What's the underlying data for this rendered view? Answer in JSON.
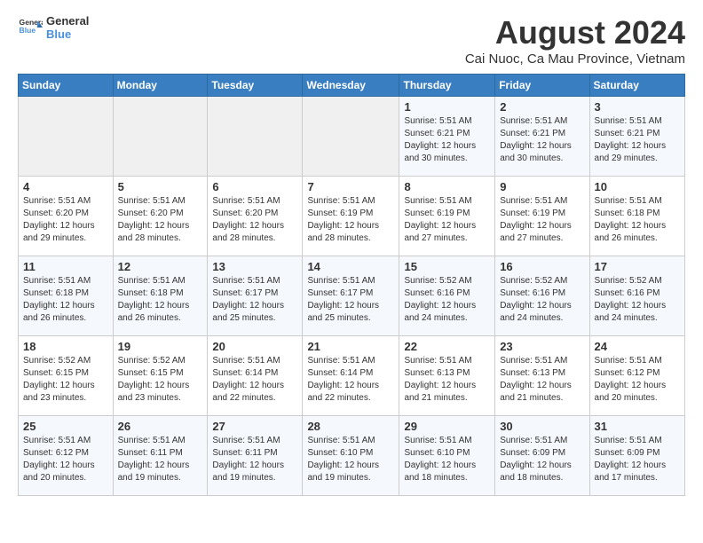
{
  "logo": {
    "line1": "General",
    "line2": "Blue"
  },
  "title": "August 2024",
  "subtitle": "Cai Nuoc, Ca Mau Province, Vietnam",
  "weekdays": [
    "Sunday",
    "Monday",
    "Tuesday",
    "Wednesday",
    "Thursday",
    "Friday",
    "Saturday"
  ],
  "weeks": [
    [
      {
        "day": "",
        "info": ""
      },
      {
        "day": "",
        "info": ""
      },
      {
        "day": "",
        "info": ""
      },
      {
        "day": "",
        "info": ""
      },
      {
        "day": "1",
        "info": "Sunrise: 5:51 AM\nSunset: 6:21 PM\nDaylight: 12 hours\nand 30 minutes."
      },
      {
        "day": "2",
        "info": "Sunrise: 5:51 AM\nSunset: 6:21 PM\nDaylight: 12 hours\nand 30 minutes."
      },
      {
        "day": "3",
        "info": "Sunrise: 5:51 AM\nSunset: 6:21 PM\nDaylight: 12 hours\nand 29 minutes."
      }
    ],
    [
      {
        "day": "4",
        "info": "Sunrise: 5:51 AM\nSunset: 6:20 PM\nDaylight: 12 hours\nand 29 minutes."
      },
      {
        "day": "5",
        "info": "Sunrise: 5:51 AM\nSunset: 6:20 PM\nDaylight: 12 hours\nand 28 minutes."
      },
      {
        "day": "6",
        "info": "Sunrise: 5:51 AM\nSunset: 6:20 PM\nDaylight: 12 hours\nand 28 minutes."
      },
      {
        "day": "7",
        "info": "Sunrise: 5:51 AM\nSunset: 6:19 PM\nDaylight: 12 hours\nand 28 minutes."
      },
      {
        "day": "8",
        "info": "Sunrise: 5:51 AM\nSunset: 6:19 PM\nDaylight: 12 hours\nand 27 minutes."
      },
      {
        "day": "9",
        "info": "Sunrise: 5:51 AM\nSunset: 6:19 PM\nDaylight: 12 hours\nand 27 minutes."
      },
      {
        "day": "10",
        "info": "Sunrise: 5:51 AM\nSunset: 6:18 PM\nDaylight: 12 hours\nand 26 minutes."
      }
    ],
    [
      {
        "day": "11",
        "info": "Sunrise: 5:51 AM\nSunset: 6:18 PM\nDaylight: 12 hours\nand 26 minutes."
      },
      {
        "day": "12",
        "info": "Sunrise: 5:51 AM\nSunset: 6:18 PM\nDaylight: 12 hours\nand 26 minutes."
      },
      {
        "day": "13",
        "info": "Sunrise: 5:51 AM\nSunset: 6:17 PM\nDaylight: 12 hours\nand 25 minutes."
      },
      {
        "day": "14",
        "info": "Sunrise: 5:51 AM\nSunset: 6:17 PM\nDaylight: 12 hours\nand 25 minutes."
      },
      {
        "day": "15",
        "info": "Sunrise: 5:52 AM\nSunset: 6:16 PM\nDaylight: 12 hours\nand 24 minutes."
      },
      {
        "day": "16",
        "info": "Sunrise: 5:52 AM\nSunset: 6:16 PM\nDaylight: 12 hours\nand 24 minutes."
      },
      {
        "day": "17",
        "info": "Sunrise: 5:52 AM\nSunset: 6:16 PM\nDaylight: 12 hours\nand 24 minutes."
      }
    ],
    [
      {
        "day": "18",
        "info": "Sunrise: 5:52 AM\nSunset: 6:15 PM\nDaylight: 12 hours\nand 23 minutes."
      },
      {
        "day": "19",
        "info": "Sunrise: 5:52 AM\nSunset: 6:15 PM\nDaylight: 12 hours\nand 23 minutes."
      },
      {
        "day": "20",
        "info": "Sunrise: 5:51 AM\nSunset: 6:14 PM\nDaylight: 12 hours\nand 22 minutes."
      },
      {
        "day": "21",
        "info": "Sunrise: 5:51 AM\nSunset: 6:14 PM\nDaylight: 12 hours\nand 22 minutes."
      },
      {
        "day": "22",
        "info": "Sunrise: 5:51 AM\nSunset: 6:13 PM\nDaylight: 12 hours\nand 21 minutes."
      },
      {
        "day": "23",
        "info": "Sunrise: 5:51 AM\nSunset: 6:13 PM\nDaylight: 12 hours\nand 21 minutes."
      },
      {
        "day": "24",
        "info": "Sunrise: 5:51 AM\nSunset: 6:12 PM\nDaylight: 12 hours\nand 20 minutes."
      }
    ],
    [
      {
        "day": "25",
        "info": "Sunrise: 5:51 AM\nSunset: 6:12 PM\nDaylight: 12 hours\nand 20 minutes."
      },
      {
        "day": "26",
        "info": "Sunrise: 5:51 AM\nSunset: 6:11 PM\nDaylight: 12 hours\nand 19 minutes."
      },
      {
        "day": "27",
        "info": "Sunrise: 5:51 AM\nSunset: 6:11 PM\nDaylight: 12 hours\nand 19 minutes."
      },
      {
        "day": "28",
        "info": "Sunrise: 5:51 AM\nSunset: 6:10 PM\nDaylight: 12 hours\nand 19 minutes."
      },
      {
        "day": "29",
        "info": "Sunrise: 5:51 AM\nSunset: 6:10 PM\nDaylight: 12 hours\nand 18 minutes."
      },
      {
        "day": "30",
        "info": "Sunrise: 5:51 AM\nSunset: 6:09 PM\nDaylight: 12 hours\nand 18 minutes."
      },
      {
        "day": "31",
        "info": "Sunrise: 5:51 AM\nSunset: 6:09 PM\nDaylight: 12 hours\nand 17 minutes."
      }
    ]
  ]
}
